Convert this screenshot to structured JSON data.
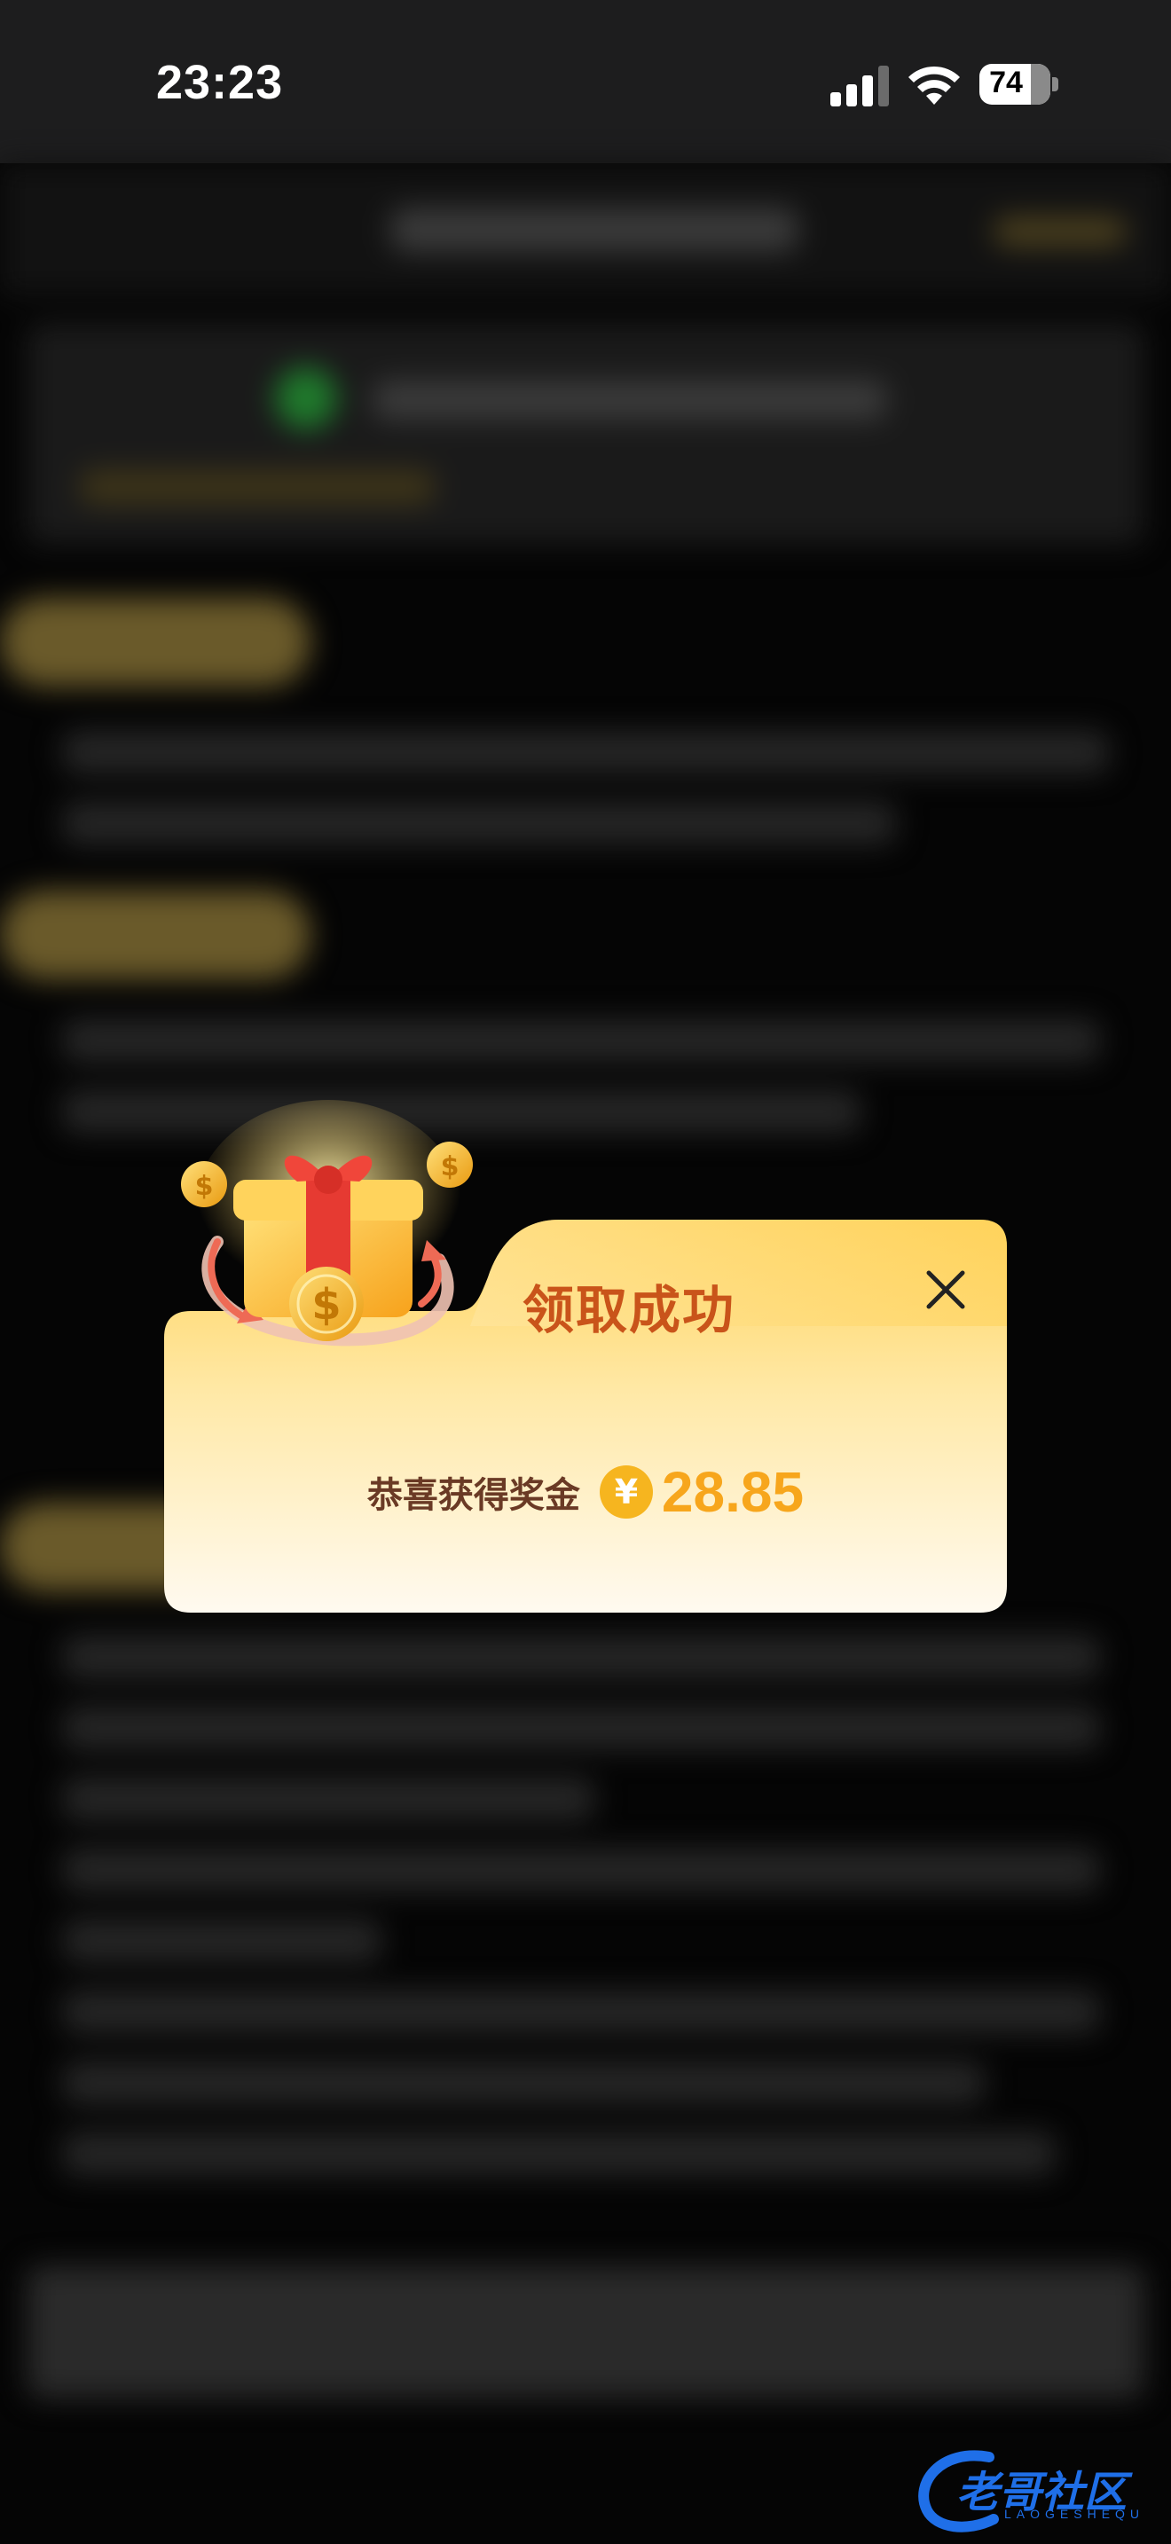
{
  "status_bar": {
    "time": "23:23",
    "battery": "74"
  },
  "modal": {
    "title": "领取成功",
    "reward_label": "恭喜获得奖金",
    "currency_symbol": "¥",
    "amount": "28.85",
    "close_icon": "close-icon"
  },
  "watermark": {
    "brand": "老哥社区",
    "sub": "LAOGESHEQU"
  },
  "colors": {
    "title": "#c9541a",
    "amount": "#f7a61c",
    "card_top": "#ffd35c",
    "card_bottom": "#fffaf0"
  }
}
